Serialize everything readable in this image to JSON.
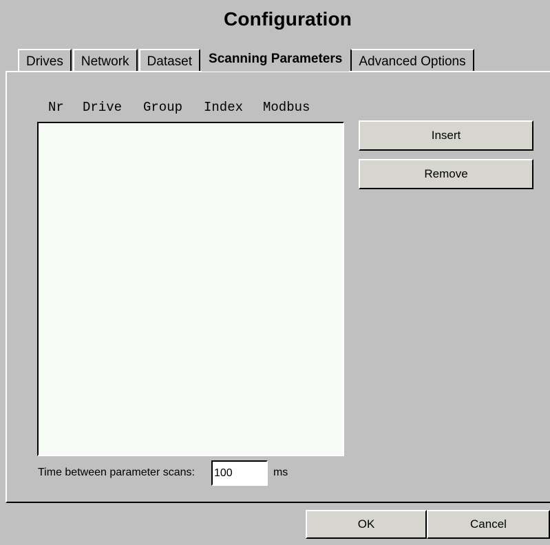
{
  "window": {
    "title": "Configuration"
  },
  "tabs": [
    {
      "label": "Drives",
      "active": false
    },
    {
      "label": "Network",
      "active": false
    },
    {
      "label": "Dataset",
      "active": false
    },
    {
      "label": "Scanning Parameters",
      "active": true
    },
    {
      "label": "Advanced Options",
      "active": false
    }
  ],
  "scanning": {
    "columns": [
      "Nr",
      "Drive",
      "Group",
      "Index",
      "Modbus"
    ],
    "rows": [],
    "insert_label": "Insert",
    "remove_label": "Remove",
    "time_label": "Time between parameter scans:",
    "time_value": "100",
    "time_unit": "ms"
  },
  "footer": {
    "ok_label": "OK",
    "cancel_label": "Cancel"
  }
}
